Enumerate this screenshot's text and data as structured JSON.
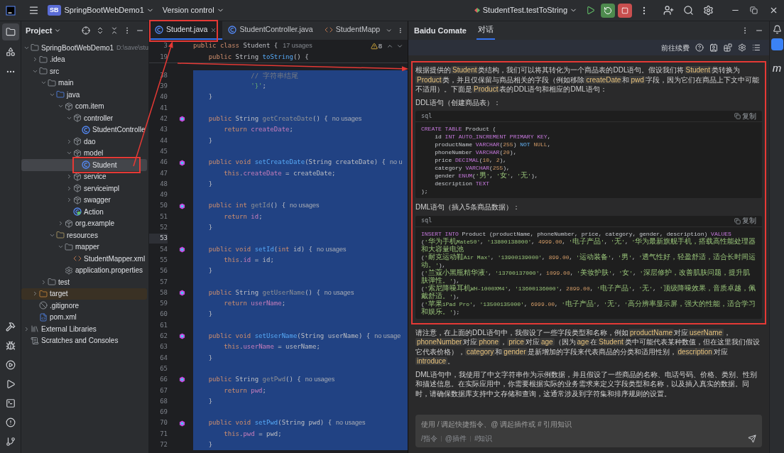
{
  "title_bar": {
    "project_badge": "SB",
    "project": "SpringBootWebDemo1",
    "vcs": "Version control",
    "run_config": "StudentTest.testToString"
  },
  "left_toolbar": {
    "top": [
      {
        "kind": "project",
        "selected": true
      },
      {
        "kind": "structure",
        "selected": false
      },
      {
        "kind": "more",
        "selected": false
      }
    ],
    "bottom": [
      {
        "kind": "build"
      },
      {
        "kind": "debug"
      },
      {
        "kind": "services"
      },
      {
        "kind": "run"
      },
      {
        "kind": "terminal"
      },
      {
        "kind": "problems"
      },
      {
        "kind": "git"
      }
    ]
  },
  "project_panel": {
    "title": "Project",
    "tree": [
      {
        "label": "SpringBootWebDemo1",
        "path": "D:\\save\\stu",
        "kind": "module",
        "expanded": true,
        "selected": false,
        "children": [
          {
            "label": ".idea",
            "kind": "folder",
            "expanded": false,
            "selected": false
          },
          {
            "label": "src",
            "kind": "folder",
            "expanded": true,
            "selected": false,
            "children": [
              {
                "label": "main",
                "kind": "folder",
                "expanded": true,
                "selected": false,
                "children": [
                  {
                    "label": "java",
                    "kind": "source-folder",
                    "expanded": true,
                    "selected": false,
                    "children": [
                      {
                        "label": "com.item",
                        "kind": "package",
                        "expanded": true,
                        "selected": false,
                        "children": [
                          {
                            "label": "controller",
                            "kind": "package",
                            "expanded": true,
                            "selected": false,
                            "children": [
                              {
                                "label": "StudentControlle",
                                "kind": "class",
                                "selected": false
                              }
                            ]
                          },
                          {
                            "label": "dao",
                            "kind": "package",
                            "expanded": false,
                            "selected": false
                          },
                          {
                            "label": "model",
                            "kind": "package",
                            "expanded": true,
                            "selected": false,
                            "children": [
                              {
                                "label": "Student",
                                "kind": "class",
                                "selected": true
                              }
                            ]
                          },
                          {
                            "label": "service",
                            "kind": "package",
                            "expanded": false,
                            "selected": false
                          },
                          {
                            "label": "serviceimpl",
                            "kind": "package",
                            "expanded": false,
                            "selected": false
                          },
                          {
                            "label": "swagger",
                            "kind": "package",
                            "expanded": false,
                            "selected": false
                          },
                          {
                            "label": "Action",
                            "kind": "runnable-class",
                            "selected": false
                          }
                        ]
                      },
                      {
                        "label": "org.example",
                        "kind": "package",
                        "expanded": false,
                        "selected": false
                      }
                    ]
                  },
                  {
                    "label": "resources",
                    "kind": "resources-folder",
                    "expanded": true,
                    "selected": false,
                    "children": [
                      {
                        "label": "mapper",
                        "kind": "folder",
                        "expanded": true,
                        "selected": false,
                        "children": [
                          {
                            "label": "StudentMapper.xml",
                            "kind": "xml",
                            "selected": false
                          }
                        ]
                      },
                      {
                        "label": "application.properties",
                        "kind": "properties",
                        "selected": false
                      }
                    ]
                  }
                ]
              },
              {
                "label": "test",
                "kind": "folder",
                "expanded": false,
                "selected": false
              }
            ]
          },
          {
            "label": "target",
            "kind": "excluded-folder",
            "expanded": false,
            "selected": false
          },
          {
            "label": ".gitignore",
            "kind": "ignore-file",
            "selected": false
          },
          {
            "label": "pom.xml",
            "kind": "maven",
            "selected": false
          }
        ]
      },
      {
        "label": "External Libraries",
        "kind": "libraries",
        "expanded": false,
        "selected": false
      },
      {
        "label": "Scratches and Consoles",
        "kind": "scratches",
        "selected": false
      }
    ]
  },
  "editor": {
    "tabs": [
      {
        "label": "Student.java",
        "kind": "class",
        "selected": true
      },
      {
        "label": "StudentController.java",
        "kind": "class",
        "selected": false
      },
      {
        "label": "StudentMapp",
        "kind": "xml",
        "selected": false
      }
    ],
    "warnings": "8",
    "sticky_lines": [
      {
        "number": "3",
        "tokens": [
          {
            "kind": "kw",
            "text": "public class "
          },
          {
            "kind": "plain",
            "text": "Student {"
          }
        ],
        "hint": "17 usages"
      },
      {
        "number": "19",
        "tokens": [
          {
            "kind": "kw",
            "text": "    public "
          },
          {
            "kind": "plain",
            "text": "String "
          },
          {
            "kind": "fn",
            "text": "toString"
          },
          {
            "kind": "plain",
            "text": "() {"
          }
        ]
      }
    ],
    "lines": [
      {
        "number": "38",
        "selected": true,
        "current": false,
        "marker": false,
        "tokens": [
          {
            "kind": "comment",
            "text": "               // 字符串结尾"
          }
        ]
      },
      {
        "number": "39",
        "selected": true,
        "current": false,
        "marker": false,
        "tokens": [
          {
            "kind": "str",
            "text": "               '}'"
          },
          {
            "kind": "plain",
            "text": ";"
          }
        ]
      },
      {
        "number": "40",
        "selected": true,
        "current": false,
        "marker": false,
        "tokens": [
          {
            "kind": "plain",
            "text": "    }"
          }
        ]
      },
      {
        "number": "41",
        "selected": true,
        "current": false,
        "marker": false
      },
      {
        "number": "42",
        "selected": true,
        "current": false,
        "marker": true,
        "tokens": [
          {
            "kind": "kw",
            "text": "    public "
          },
          {
            "kind": "plain",
            "text": "String "
          },
          {
            "kind": "dim",
            "text": "getCreateDate"
          },
          {
            "kind": "plain",
            "text": "() {"
          }
        ],
        "hint": "no usages"
      },
      {
        "number": "43",
        "selected": true,
        "current": false,
        "marker": false,
        "tokens": [
          {
            "kind": "kw",
            "text": "        return "
          },
          {
            "kind": "field",
            "text": "createDate"
          },
          {
            "kind": "plain",
            "text": ";"
          }
        ]
      },
      {
        "number": "44",
        "selected": true,
        "current": false,
        "marker": false,
        "tokens": [
          {
            "kind": "plain",
            "text": "    }"
          }
        ]
      },
      {
        "number": "45",
        "selected": true,
        "current": false,
        "marker": false
      },
      {
        "number": "46",
        "selected": true,
        "current": false,
        "marker": true,
        "tokens": [
          {
            "kind": "kw",
            "text": "    public void "
          },
          {
            "kind": "fn",
            "text": "setCreateDate"
          },
          {
            "kind": "plain",
            "text": "(String createDate) {"
          }
        ],
        "hint": "no u"
      },
      {
        "number": "47",
        "selected": true,
        "current": false,
        "marker": false,
        "tokens": [
          {
            "kind": "kw",
            "text": "        this"
          },
          {
            "kind": "plain",
            "text": "."
          },
          {
            "kind": "field",
            "text": "createDate"
          },
          {
            "kind": "plain",
            "text": " = createDate;"
          }
        ]
      },
      {
        "number": "48",
        "selected": true,
        "current": false,
        "marker": false,
        "tokens": [
          {
            "kind": "plain",
            "text": "    }"
          }
        ]
      },
      {
        "number": "49",
        "selected": true,
        "current": false,
        "marker": false
      },
      {
        "number": "50",
        "selected": true,
        "current": false,
        "marker": true,
        "tokens": [
          {
            "kind": "kw",
            "text": "    public int "
          },
          {
            "kind": "dim",
            "text": "getId"
          },
          {
            "kind": "plain",
            "text": "() {"
          }
        ],
        "hint": "no usages"
      },
      {
        "number": "51",
        "selected": true,
        "current": false,
        "marker": false,
        "tokens": [
          {
            "kind": "kw",
            "text": "        return "
          },
          {
            "kind": "field",
            "text": "id"
          },
          {
            "kind": "plain",
            "text": ";"
          }
        ]
      },
      {
        "number": "52",
        "selected": true,
        "current": false,
        "marker": false,
        "tokens": [
          {
            "kind": "plain",
            "text": "    }"
          }
        ]
      },
      {
        "number": "53",
        "selected": true,
        "current": true,
        "marker": false
      },
      {
        "number": "54",
        "selected": true,
        "current": false,
        "marker": true,
        "tokens": [
          {
            "kind": "kw",
            "text": "    public void "
          },
          {
            "kind": "fn",
            "text": "setId"
          },
          {
            "kind": "plain",
            "text": "("
          },
          {
            "kind": "kw",
            "text": "int"
          },
          {
            "kind": "plain",
            "text": " id) {"
          }
        ],
        "hint": "no usages"
      },
      {
        "number": "55",
        "selected": true,
        "current": false,
        "marker": false,
        "tokens": [
          {
            "kind": "kw",
            "text": "        this"
          },
          {
            "kind": "plain",
            "text": "."
          },
          {
            "kind": "field",
            "text": "id"
          },
          {
            "kind": "plain",
            "text": " = id;"
          }
        ]
      },
      {
        "number": "56",
        "selected": true,
        "current": false,
        "marker": false,
        "tokens": [
          {
            "kind": "plain",
            "text": "    }"
          }
        ]
      },
      {
        "number": "57",
        "selected": true,
        "current": false,
        "marker": false
      },
      {
        "number": "58",
        "selected": true,
        "current": false,
        "marker": true,
        "tokens": [
          {
            "kind": "kw",
            "text": "    public "
          },
          {
            "kind": "plain",
            "text": "String "
          },
          {
            "kind": "dim",
            "text": "getUserName"
          },
          {
            "kind": "plain",
            "text": "() {"
          }
        ],
        "hint": "no usages"
      },
      {
        "number": "59",
        "selected": true,
        "current": false,
        "marker": false,
        "tokens": [
          {
            "kind": "kw",
            "text": "        return "
          },
          {
            "kind": "field",
            "text": "userName"
          },
          {
            "kind": "plain",
            "text": ";"
          }
        ]
      },
      {
        "number": "60",
        "selected": true,
        "current": false,
        "marker": false,
        "tokens": [
          {
            "kind": "plain",
            "text": "    }"
          }
        ]
      },
      {
        "number": "61",
        "selected": true,
        "current": false,
        "marker": false
      },
      {
        "number": "62",
        "selected": true,
        "current": false,
        "marker": true,
        "tokens": [
          {
            "kind": "kw",
            "text": "    public void "
          },
          {
            "kind": "fn",
            "text": "setUserName"
          },
          {
            "kind": "plain",
            "text": "(String userName) {"
          }
        ],
        "hint": "no usage"
      },
      {
        "number": "63",
        "selected": true,
        "current": false,
        "marker": false,
        "tokens": [
          {
            "kind": "kw",
            "text": "        this"
          },
          {
            "kind": "plain",
            "text": "."
          },
          {
            "kind": "field",
            "text": "userName"
          },
          {
            "kind": "plain",
            "text": " = userName;"
          }
        ]
      },
      {
        "number": "64",
        "selected": true,
        "current": false,
        "marker": false,
        "tokens": [
          {
            "kind": "plain",
            "text": "    }"
          }
        ]
      },
      {
        "number": "65",
        "selected": true,
        "current": false,
        "marker": false
      },
      {
        "number": "66",
        "selected": true,
        "current": false,
        "marker": true,
        "tokens": [
          {
            "kind": "kw",
            "text": "    public "
          },
          {
            "kind": "plain",
            "text": "String "
          },
          {
            "kind": "dim",
            "text": "getPwd"
          },
          {
            "kind": "plain",
            "text": "() {"
          }
        ],
        "hint": "no usages"
      },
      {
        "number": "67",
        "selected": true,
        "current": false,
        "marker": false,
        "tokens": [
          {
            "kind": "kw",
            "text": "        return "
          },
          {
            "kind": "field",
            "text": "pwd"
          },
          {
            "kind": "plain",
            "text": ";"
          }
        ]
      },
      {
        "number": "68",
        "selected": true,
        "current": false,
        "marker": false,
        "tokens": [
          {
            "kind": "plain",
            "text": "    }"
          }
        ]
      },
      {
        "number": "69",
        "selected": true,
        "current": false,
        "marker": false
      },
      {
        "number": "70",
        "selected": true,
        "current": false,
        "marker": true,
        "tokens": [
          {
            "kind": "kw",
            "text": "    public void "
          },
          {
            "kind": "fn",
            "text": "setPwd"
          },
          {
            "kind": "plain",
            "text": "(String pwd) {"
          }
        ],
        "hint": "no usages"
      },
      {
        "number": "71",
        "selected": true,
        "current": false,
        "marker": false,
        "tokens": [
          {
            "kind": "kw",
            "text": "        this"
          },
          {
            "kind": "plain",
            "text": "."
          },
          {
            "kind": "field",
            "text": "pwd"
          },
          {
            "kind": "plain",
            "text": " = pwd;"
          }
        ]
      },
      {
        "number": "72",
        "selected": true,
        "current": false,
        "marker": false,
        "tokens": [
          {
            "kind": "plain",
            "text": "    }"
          }
        ]
      }
    ]
  },
  "chat": {
    "title": "Baidu Comate",
    "tabs": [
      {
        "label": "对话",
        "selected": true
      }
    ],
    "renew_link": "前往续费",
    "blocks": [
      {
        "kind": "paragraph",
        "annotated": true,
        "text": "根据提供的**Student**类结构，我们可以将其转化为一个商品表的DDL语句。假设我们将**Student**类转换为**Product**类，并且仅保留与商品相关的字段（例如移除**createDate**和**pwd**字段，因为它们在商品上下文中可能不适用）。下面是**Product**表的DDL语句和相应的DML语句："
      },
      {
        "kind": "paragraph",
        "annotated": true,
        "text": "DDL语句（创建商品表）："
      },
      {
        "kind": "code",
        "annotated": true,
        "language": "sql",
        "copy_label": "复制",
        "lines": [
          [
            {
              "kind": "kw",
              "text": "CREATE TABLE"
            },
            {
              "kind": "plain",
              "text": " Product ("
            }
          ],
          [
            {
              "kind": "plain",
              "text": "    id "
            },
            {
              "kind": "kw",
              "text": "INT AUTO_INCREMENT PRIMARY KEY"
            },
            {
              "kind": "plain",
              "text": ","
            }
          ],
          [
            {
              "kind": "plain",
              "text": "    productName "
            },
            {
              "kind": "kw",
              "text": "VARCHAR"
            },
            {
              "kind": "plain",
              "text": "("
            },
            {
              "kind": "num",
              "text": "255"
            },
            {
              "kind": "plain",
              "text": ") "
            },
            {
              "kind": "op",
              "text": "NOT "
            },
            {
              "kind": "num",
              "text": "NULL"
            },
            {
              "kind": "plain",
              "text": ","
            }
          ],
          [
            {
              "kind": "plain",
              "text": "    phoneNumber "
            },
            {
              "kind": "kw",
              "text": "VARCHAR"
            },
            {
              "kind": "plain",
              "text": "("
            },
            {
              "kind": "num",
              "text": "20"
            },
            {
              "kind": "plain",
              "text": "),"
            }
          ],
          [
            {
              "kind": "plain",
              "text": "    price "
            },
            {
              "kind": "kw",
              "text": "DECIMAL"
            },
            {
              "kind": "plain",
              "text": "("
            },
            {
              "kind": "num",
              "text": "10"
            },
            {
              "kind": "plain",
              "text": ", "
            },
            {
              "kind": "num",
              "text": "2"
            },
            {
              "kind": "plain",
              "text": "),"
            }
          ],
          [
            {
              "kind": "plain",
              "text": "    category "
            },
            {
              "kind": "kw",
              "text": "VARCHAR"
            },
            {
              "kind": "plain",
              "text": "("
            },
            {
              "kind": "num",
              "text": "255"
            },
            {
              "kind": "plain",
              "text": "),"
            }
          ],
          [
            {
              "kind": "plain",
              "text": "    gender "
            },
            {
              "kind": "kw",
              "text": "ENUM"
            },
            {
              "kind": "plain",
              "text": "("
            },
            {
              "kind": "str",
              "text": "'男'"
            },
            {
              "kind": "plain",
              "text": ", "
            },
            {
              "kind": "str",
              "text": "'女'"
            },
            {
              "kind": "plain",
              "text": ", "
            },
            {
              "kind": "str",
              "text": "'无'"
            },
            {
              "kind": "plain",
              "text": "),"
            }
          ],
          [
            {
              "kind": "plain",
              "text": "    description "
            },
            {
              "kind": "kw",
              "text": "TEXT"
            }
          ],
          [
            {
              "kind": "plain",
              "text": ");"
            }
          ]
        ]
      },
      {
        "kind": "paragraph",
        "annotated": true,
        "text": "DML语句（插入5条商品数据）："
      },
      {
        "kind": "code",
        "annotated": true,
        "language": "sql",
        "copy_label": "复制",
        "lines": [
          [
            {
              "kind": "kw",
              "text": "INSERT INTO"
            },
            {
              "kind": "plain",
              "text": " Product (productName, phoneNumber, price, category, gender, description) "
            },
            {
              "kind": "kw",
              "text": "VALUES"
            }
          ],
          [
            {
              "kind": "plain",
              "text": "("
            },
            {
              "kind": "str",
              "text": "'华为手机Mate50'"
            },
            {
              "kind": "plain",
              "text": ", "
            },
            {
              "kind": "str",
              "text": "'13800138000'"
            },
            {
              "kind": "plain",
              "text": ", "
            },
            {
              "kind": "num",
              "text": "4999.00"
            },
            {
              "kind": "plain",
              "text": ", "
            },
            {
              "kind": "str",
              "text": "'电子产品'"
            },
            {
              "kind": "plain",
              "text": ", "
            },
            {
              "kind": "str",
              "text": "'无'"
            },
            {
              "kind": "plain",
              "text": ", "
            },
            {
              "kind": "str",
              "text": "'华为最新旗舰手机，搭载高性能处理器和大容量电池"
            }
          ],
          [
            {
              "kind": "plain",
              "text": "("
            },
            {
              "kind": "str",
              "text": "'耐克运动鞋Air Max'"
            },
            {
              "kind": "plain",
              "text": ", "
            },
            {
              "kind": "str",
              "text": "'13900139000'"
            },
            {
              "kind": "plain",
              "text": ", "
            },
            {
              "kind": "num",
              "text": "899.00"
            },
            {
              "kind": "plain",
              "text": ", "
            },
            {
              "kind": "str",
              "text": "'运动装备'"
            },
            {
              "kind": "plain",
              "text": ", "
            },
            {
              "kind": "str",
              "text": "'男'"
            },
            {
              "kind": "plain",
              "text": ", "
            },
            {
              "kind": "str",
              "text": "'透气性好，轻盈舒适，适合长时间运动。'"
            },
            {
              "kind": "plain",
              "text": "),"
            }
          ],
          [
            {
              "kind": "plain",
              "text": "("
            },
            {
              "kind": "str",
              "text": "'兰蔻小黑瓶精华液'"
            },
            {
              "kind": "plain",
              "text": ", "
            },
            {
              "kind": "str",
              "text": "'13700137000'"
            },
            {
              "kind": "plain",
              "text": ", "
            },
            {
              "kind": "num",
              "text": "1099.00"
            },
            {
              "kind": "plain",
              "text": ", "
            },
            {
              "kind": "str",
              "text": "'美妆护肤'"
            },
            {
              "kind": "plain",
              "text": ", "
            },
            {
              "kind": "str",
              "text": "'女'"
            },
            {
              "kind": "plain",
              "text": ", "
            },
            {
              "kind": "str",
              "text": "'深层修护，改善肌肤问题，提升肌肤弹性。'"
            },
            {
              "kind": "plain",
              "text": "),"
            }
          ],
          [
            {
              "kind": "plain",
              "text": "("
            },
            {
              "kind": "str",
              "text": "'索尼降噪耳机WH-1000XM4'"
            },
            {
              "kind": "plain",
              "text": ", "
            },
            {
              "kind": "str",
              "text": "'13600136000'"
            },
            {
              "kind": "plain",
              "text": ", "
            },
            {
              "kind": "num",
              "text": "2899.00"
            },
            {
              "kind": "plain",
              "text": ", "
            },
            {
              "kind": "str",
              "text": "'电子产品'"
            },
            {
              "kind": "plain",
              "text": ", "
            },
            {
              "kind": "str",
              "text": "'无'"
            },
            {
              "kind": "plain",
              "text": ", "
            },
            {
              "kind": "str",
              "text": "'顶级降噪效果，音质卓越，佩戴舒适。'"
            },
            {
              "kind": "plain",
              "text": "),"
            }
          ],
          [
            {
              "kind": "plain",
              "text": "("
            },
            {
              "kind": "str",
              "text": "'苹果iPad Pro'"
            },
            {
              "kind": "plain",
              "text": ", "
            },
            {
              "kind": "str",
              "text": "'13500135000'"
            },
            {
              "kind": "plain",
              "text": ", "
            },
            {
              "kind": "num",
              "text": "6999.00"
            },
            {
              "kind": "plain",
              "text": ", "
            },
            {
              "kind": "str",
              "text": "'电子产品'"
            },
            {
              "kind": "plain",
              "text": ", "
            },
            {
              "kind": "str",
              "text": "'无'"
            },
            {
              "kind": "plain",
              "text": ", "
            },
            {
              "kind": "str",
              "text": "'高分辨率显示屏，强大的性能，适合学习和娱乐。'"
            },
            {
              "kind": "plain",
              "text": ");"
            }
          ]
        ]
      },
      {
        "kind": "paragraph",
        "annotated": false,
        "text": "请注意，在上面的DDL语句中，我假设了一些字段类型和名称，例如**productName**对应**userName**，**phoneNumber**对应**phone**，**price**对应**age**（因为**age**在**Student**类中可能代表某种数值，但在这里我们假设它代表价格），**category**和**gender**是新增加的字段来代表商品的分类和适用性别，**description**对应**introduce**。"
      },
      {
        "kind": "paragraph",
        "annotated": false,
        "text": "DML语句中，我使用了中文字符串作为示例数据，并且假设了一些商品的名称、电话号码、价格、类别、性别和描述信息。在实际应用中，你需要根据实际的业务需求来定义字段类型和名称，以及插入真实的数据。同时，请确保数据库支持中文存储和查询，这通常涉及到字符集和排序规则的设置。"
      }
    ],
    "input": {
      "placeholder": "使用 / 调起快捷指令、@ 调起插件或 # 引用知识",
      "shortcuts": [
        "/指令",
        "@插件",
        "#知识"
      ]
    }
  },
  "right_strip": {
    "letter": "m"
  }
}
